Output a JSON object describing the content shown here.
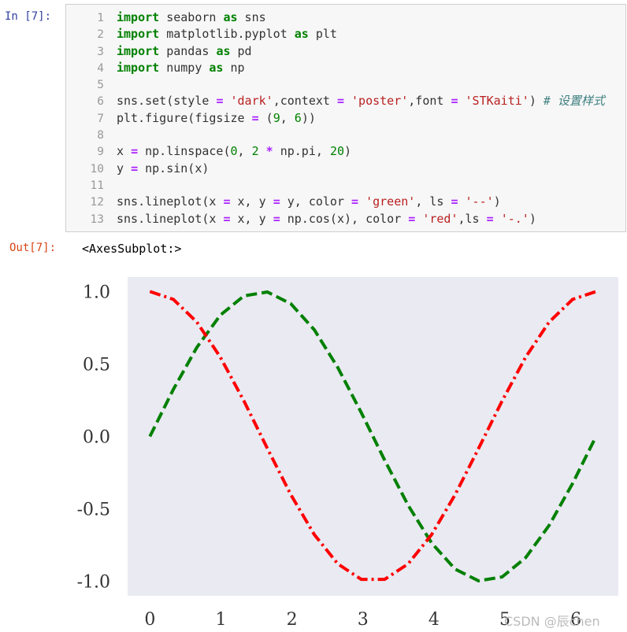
{
  "cell": {
    "in_prompt": "In  [7]:",
    "out_prompt": "Out[7]:",
    "output_text": "<AxesSubplot:>"
  },
  "code_lines": [
    {
      "n": "1",
      "tokens": [
        [
          "kw",
          "import"
        ],
        [
          "t",
          " seaborn "
        ],
        [
          "kw",
          "as"
        ],
        [
          "t",
          " sns"
        ]
      ]
    },
    {
      "n": "2",
      "tokens": [
        [
          "kw",
          "import"
        ],
        [
          "t",
          " matplotlib.pyplot "
        ],
        [
          "kw",
          "as"
        ],
        [
          "t",
          " plt"
        ]
      ]
    },
    {
      "n": "3",
      "tokens": [
        [
          "kw",
          "import"
        ],
        [
          "t",
          " pandas "
        ],
        [
          "kw",
          "as"
        ],
        [
          "t",
          " pd"
        ]
      ]
    },
    {
      "n": "4",
      "tokens": [
        [
          "kw",
          "import"
        ],
        [
          "t",
          " numpy "
        ],
        [
          "kw",
          "as"
        ],
        [
          "t",
          " np"
        ]
      ]
    },
    {
      "n": "5",
      "tokens": []
    },
    {
      "n": "6",
      "tokens": [
        [
          "t",
          "sns.set(style "
        ],
        [
          "op",
          "="
        ],
        [
          "t",
          " "
        ],
        [
          "str",
          "'dark'"
        ],
        [
          "t",
          ",context "
        ],
        [
          "op",
          "="
        ],
        [
          "t",
          " "
        ],
        [
          "str",
          "'poster'"
        ],
        [
          "t",
          ",font "
        ],
        [
          "op",
          "="
        ],
        [
          "t",
          " "
        ],
        [
          "str",
          "'STKaiti'"
        ],
        [
          "t",
          ") "
        ],
        [
          "cm",
          "# 设置样式"
        ]
      ]
    },
    {
      "n": "7",
      "tokens": [
        [
          "t",
          "plt.figure(figsize "
        ],
        [
          "op",
          "="
        ],
        [
          "t",
          " ("
        ],
        [
          "num",
          "9"
        ],
        [
          "t",
          ", "
        ],
        [
          "num",
          "6"
        ],
        [
          "t",
          "))"
        ]
      ]
    },
    {
      "n": "8",
      "tokens": []
    },
    {
      "n": "9",
      "tokens": [
        [
          "t",
          "x "
        ],
        [
          "op",
          "="
        ],
        [
          "t",
          " np.linspace("
        ],
        [
          "num",
          "0"
        ],
        [
          "t",
          ", "
        ],
        [
          "num",
          "2"
        ],
        [
          "t",
          " "
        ],
        [
          "op",
          "*"
        ],
        [
          "t",
          " np.pi, "
        ],
        [
          "num",
          "20"
        ],
        [
          "t",
          ")"
        ]
      ]
    },
    {
      "n": "10",
      "tokens": [
        [
          "t",
          "y "
        ],
        [
          "op",
          "="
        ],
        [
          "t",
          " np.sin(x)"
        ]
      ]
    },
    {
      "n": "11",
      "tokens": []
    },
    {
      "n": "12",
      "tokens": [
        [
          "t",
          "sns.lineplot(x "
        ],
        [
          "op",
          "="
        ],
        [
          "t",
          " x, y "
        ],
        [
          "op",
          "="
        ],
        [
          "t",
          " y, color "
        ],
        [
          "op",
          "="
        ],
        [
          "t",
          " "
        ],
        [
          "str",
          "'green'"
        ],
        [
          "t",
          ", ls "
        ],
        [
          "op",
          "="
        ],
        [
          "t",
          " "
        ],
        [
          "str",
          "'--'"
        ],
        [
          "t",
          ")"
        ]
      ]
    },
    {
      "n": "13",
      "tokens": [
        [
          "t",
          "sns.lineplot(x "
        ],
        [
          "op",
          "="
        ],
        [
          "t",
          " x, y "
        ],
        [
          "op",
          "="
        ],
        [
          "t",
          " np.cos(x), color "
        ],
        [
          "op",
          "="
        ],
        [
          "t",
          " "
        ],
        [
          "str",
          "'red'"
        ],
        [
          "t",
          ",ls "
        ],
        [
          "op",
          "="
        ],
        [
          "t",
          " "
        ],
        [
          "str",
          "'-.'"
        ],
        [
          "t",
          ")"
        ]
      ]
    }
  ],
  "chart_data": {
    "type": "line",
    "x": [
      0,
      0.3307,
      0.6614,
      0.9921,
      1.3228,
      1.6535,
      1.9842,
      2.3149,
      2.6456,
      2.9762,
      3.3069,
      3.6376,
      3.9683,
      4.299,
      4.6297,
      4.9604,
      5.2911,
      5.6218,
      5.9525,
      6.2832
    ],
    "series": [
      {
        "color": "#008000",
        "style": "dashed",
        "values": [
          0,
          0.3247,
          0.6142,
          0.8372,
          0.9694,
          0.9966,
          0.9158,
          0.7357,
          0.4759,
          0.1646,
          -0.1646,
          -0.4759,
          -0.7357,
          -0.9158,
          -0.9966,
          -0.9694,
          -0.8372,
          -0.6142,
          -0.3247,
          0
        ]
      },
      {
        "color": "#ff0000",
        "style": "dashdot",
        "values": [
          1,
          0.9458,
          0.7891,
          0.5469,
          0.2455,
          -0.0826,
          -0.4017,
          -0.6773,
          -0.8795,
          -0.9864,
          -0.9864,
          -0.8795,
          -0.6773,
          -0.4017,
          -0.0826,
          0.2455,
          0.5469,
          0.7891,
          0.9458,
          1
        ]
      }
    ],
    "xticks": [
      "0",
      "1",
      "2",
      "3",
      "4",
      "5",
      "6"
    ],
    "yticks": [
      "1.0",
      "0.5",
      "0.0",
      "-0.5",
      "-1.0"
    ],
    "xlim": [
      -0.3142,
      6.5973
    ],
    "ylim": [
      -1.0998,
      1.0998
    ],
    "grid": false,
    "background": "#eaeaf2"
  },
  "watermark": "CSDN @辰chen"
}
